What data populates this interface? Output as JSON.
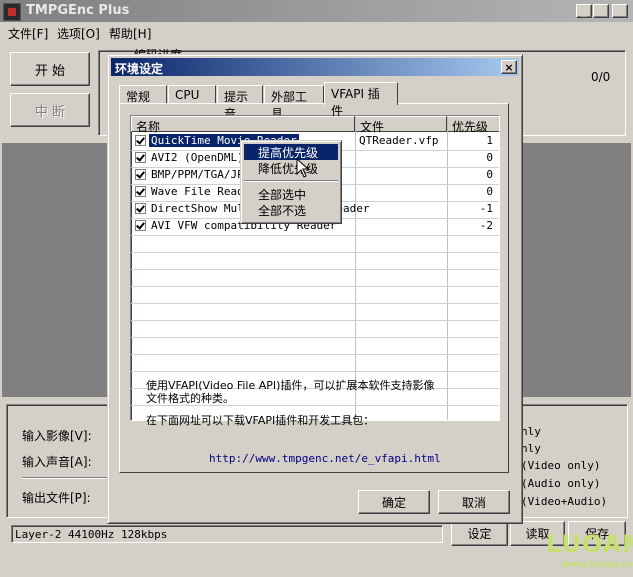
{
  "app": {
    "title": "TMPGEnc Plus"
  },
  "menu": [
    {
      "label": "文件[F]"
    },
    {
      "label": "选项[O]"
    },
    {
      "label": "帮助[H]"
    }
  ],
  "main": {
    "start_button": "开 始",
    "stop_button": "中 断",
    "progress_label": "编码进度",
    "progress_count": "0/0",
    "input_video_label": "输入影像[V]:",
    "input_audio_label": "输入声音[A]:",
    "output_file_label": "输出文件[P]:",
    "stream_type_fragments": [
      "nly",
      "nly",
      "(Video only)",
      "(Audio only)",
      "(Video+Audio)"
    ],
    "status_text": "Layer-2 44100Hz 128kbps",
    "setup_button": "设定",
    "load_button": "读取",
    "save_button": "保存"
  },
  "dialog": {
    "title": "环境设定",
    "tabs": [
      {
        "label": "常规"
      },
      {
        "label": "CPU"
      },
      {
        "label": "提示音"
      },
      {
        "label": "外部工具"
      },
      {
        "label": "VFAPI 插件"
      }
    ],
    "active_tab": 4,
    "columns": {
      "name": "名称",
      "file": "文件",
      "priority": "优先级"
    },
    "plugins": [
      {
        "name": "QuickTime Movie Reader",
        "file": "QTReader.vfp",
        "priority": "1"
      },
      {
        "name": "AVI2 (OpenDML) Reader",
        "file": "",
        "priority": "0"
      },
      {
        "name": "BMP/PPM/TGA/JPEG Reader",
        "file": "",
        "priority": "0"
      },
      {
        "name": "Wave File Reader",
        "file": "",
        "priority": "0"
      },
      {
        "name": "DirectShow Multimedia File Reader",
        "file": "",
        "priority": "-1"
      },
      {
        "name": "AVI VFW compatibility Reader",
        "file": "",
        "priority": "-2"
      }
    ],
    "description_line1": "使用VFAPI(Video File API)插件，可以扩展本软件支持影像",
    "description_line2": "文件格式的种类。",
    "download_text": "在下面网址可以下载VFAPI插件和开发工具包：",
    "url": "http://www.tmpgenc.net/e_vfapi.html",
    "ok_button": "确定",
    "cancel_button": "取消"
  },
  "context_menu": [
    {
      "label": "提高优先级"
    },
    {
      "label": "降低优先级"
    },
    {
      "label": "全部选中"
    },
    {
      "label": "全部不选"
    }
  ],
  "watermark": {
    "brand": "LUOAN",
    "site": "www.luoan.cn"
  },
  "colors": {
    "selection": "#0a246a",
    "dialog_title_start": "#0a246a",
    "dialog_title_end": "#a6caf0",
    "face": "#d4d0c8"
  }
}
